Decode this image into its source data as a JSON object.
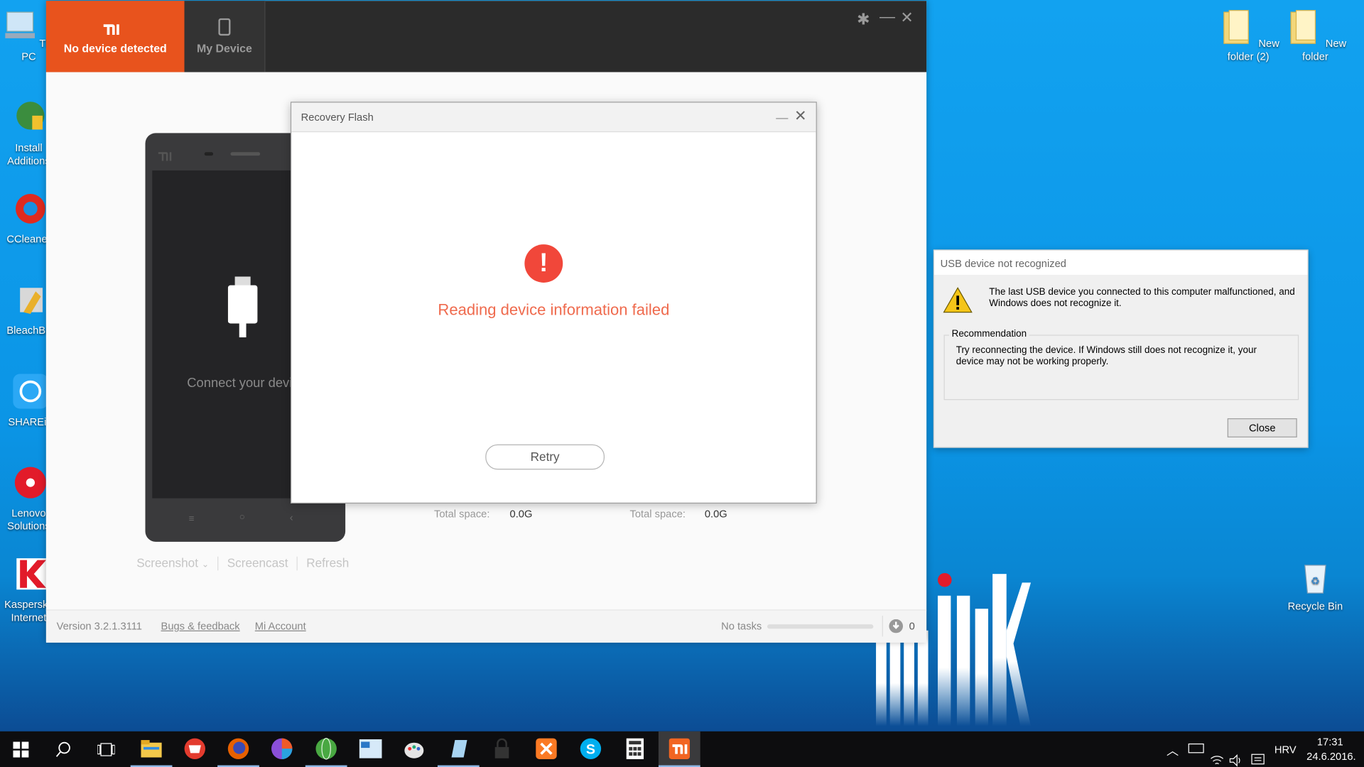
{
  "desktop": {
    "icons_left": [
      {
        "label": "This PC"
      },
      {
        "label": "Install Additions"
      },
      {
        "label": "CCleaner"
      },
      {
        "label": "BleachBit"
      },
      {
        "label": "SHAREit"
      },
      {
        "label": "Lenovo Solutions"
      },
      {
        "label": "Kaspersky Internet"
      }
    ],
    "icons_right": [
      {
        "label": "New folder (2)"
      },
      {
        "label": "New folder"
      },
      {
        "label": "Recycle Bin"
      }
    ],
    "wallpaper_text": "hink"
  },
  "mi_window": {
    "tabs": [
      {
        "label": "No device detected",
        "active": true
      },
      {
        "label": "My Device",
        "active": false
      }
    ],
    "phone_caption": "Connect your device",
    "phone_actions": [
      "Screenshot",
      "Screencast",
      "Refresh"
    ],
    "storage": [
      {
        "label": "Total space:",
        "value": "0.0G"
      },
      {
        "label": "Total space:",
        "value": "0.0G"
      }
    ],
    "footer": {
      "version": "Version 3.2.1.3111",
      "bugs_link": "Bugs & feedback",
      "account_link": "Mi Account",
      "tasks": "No tasks",
      "download_count": "0"
    },
    "accent_color": "#e8531d"
  },
  "recovery_dialog": {
    "title": "Recovery Flash",
    "message": "Reading device information failed",
    "retry_label": "Retry",
    "error_color": "#f1473a"
  },
  "usb_dialog": {
    "title": "USB device not recognized",
    "message": "The last USB device you connected to this computer malfunctioned, and Windows does not recognize it.",
    "group_label": "Recommendation",
    "recommendation": "Try reconnecting the device. If Windows still does not recognize it, your device may not be working properly.",
    "close_label": "Close"
  },
  "taskbar": {
    "apps": [
      "start-icon",
      "search-icon",
      "task-view-icon",
      "file-explorer-icon",
      "app-red-icon",
      "firefox-icon",
      "browser-icon",
      "globe-icon",
      "outlook-icon",
      "paint-icon",
      "notepad-icon",
      "lock-icon",
      "xampp-icon",
      "skype-icon",
      "calculator-icon",
      "mi-suite-icon"
    ],
    "language": "HRV",
    "time": "17:31",
    "date": "24.6.2016."
  }
}
